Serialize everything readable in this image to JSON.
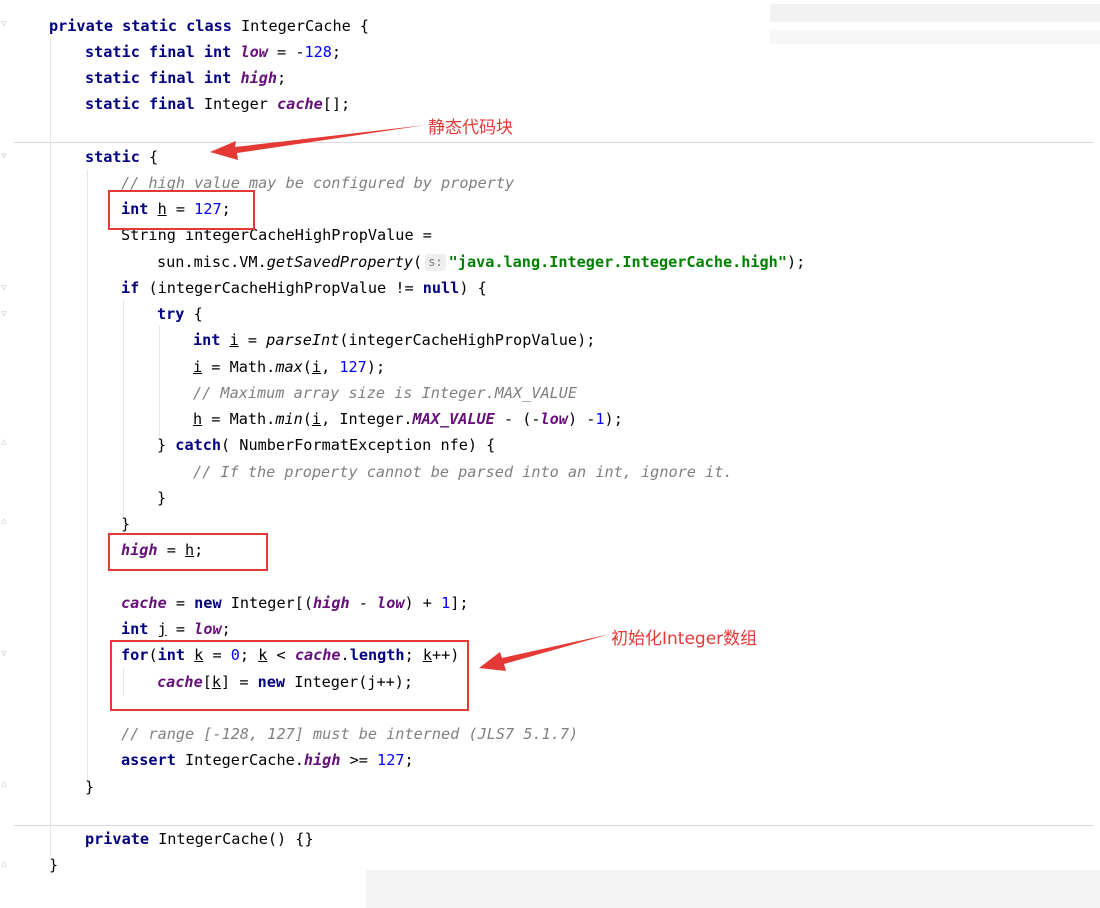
{
  "annotations": {
    "static_block_label": "静态代码块",
    "init_array_label": "初始化Integer数组",
    "colors": {
      "annotation_red": "#e53935"
    }
  },
  "editor": {
    "icons": [
      "fold-arrow-icon",
      "parameter-hint-icon"
    ],
    "colors": {
      "keyword": "#000080",
      "number": "#0000ff",
      "field": "#660e7a",
      "comment": "#808080",
      "string": "#008000",
      "text": "#000000"
    },
    "code_lines": [
      {
        "tokens": [
          {
            "t": "private static class ",
            "c": "kw"
          },
          {
            "t": "IntegerCache {"
          }
        ]
      },
      {
        "tokens": [
          {
            "t": "static final int ",
            "c": "kw"
          },
          {
            "t": "low",
            "c": "fld"
          },
          {
            "t": " = -"
          },
          {
            "t": "128",
            "c": "num"
          },
          {
            "t": ";"
          }
        ]
      },
      {
        "tokens": [
          {
            "t": "static final int ",
            "c": "kw"
          },
          {
            "t": "high",
            "c": "fld"
          },
          {
            "t": ";"
          }
        ]
      },
      {
        "tokens": [
          {
            "t": "static final ",
            "c": "kw"
          },
          {
            "t": "Integer "
          },
          {
            "t": "cache",
            "c": "fld"
          },
          {
            "t": "[];"
          }
        ]
      },
      {
        "tokens": [
          {
            "t": "static ",
            "c": "kw"
          },
          {
            "t": "{"
          }
        ]
      },
      {
        "tokens": [
          {
            "t": "// high value may be configured by property",
            "c": "cmt"
          }
        ]
      },
      {
        "tokens": [
          {
            "t": "int ",
            "c": "kw"
          },
          {
            "t": "h",
            "c": "ul"
          },
          {
            "t": " = "
          },
          {
            "t": "127",
            "c": "num"
          },
          {
            "t": ";"
          }
        ]
      },
      {
        "tokens": [
          {
            "t": "String integerCacheHighPropValue ="
          }
        ]
      },
      {
        "tokens": [
          {
            "t": "sun.misc.VM."
          },
          {
            "t": "getSavedProperty",
            "c": "mth"
          },
          {
            "t": "("
          },
          {
            "t": "s:",
            "c": "hint"
          },
          {
            "t": "\"java.lang.Integer.IntegerCache.high\"",
            "c": "str"
          },
          {
            "t": ");"
          }
        ]
      },
      {
        "tokens": [
          {
            "t": "if ",
            "c": "kw"
          },
          {
            "t": "(integerCacheHighPropValue != "
          },
          {
            "t": "null",
            "c": "kw"
          },
          {
            "t": ") {"
          }
        ]
      },
      {
        "tokens": [
          {
            "t": "try ",
            "c": "kw"
          },
          {
            "t": "{"
          }
        ]
      },
      {
        "tokens": [
          {
            "t": "int ",
            "c": "kw"
          },
          {
            "t": "i",
            "c": "ul"
          },
          {
            "t": " = "
          },
          {
            "t": "parseInt",
            "c": "mth"
          },
          {
            "t": "(integerCacheHighPropValue);"
          }
        ]
      },
      {
        "tokens": [
          {
            "t": "i",
            "c": "ul"
          },
          {
            "t": " = Math."
          },
          {
            "t": "max",
            "c": "mth"
          },
          {
            "t": "("
          },
          {
            "t": "i",
            "c": "ul"
          },
          {
            "t": ", "
          },
          {
            "t": "127",
            "c": "num"
          },
          {
            "t": ");"
          }
        ]
      },
      {
        "tokens": [
          {
            "t": "// Maximum array size is Integer.MAX_VALUE",
            "c": "cmt"
          }
        ]
      },
      {
        "tokens": [
          {
            "t": "h",
            "c": "ul"
          },
          {
            "t": " = Math."
          },
          {
            "t": "min",
            "c": "mth"
          },
          {
            "t": "("
          },
          {
            "t": "i",
            "c": "ul"
          },
          {
            "t": ", Integer."
          },
          {
            "t": "MAX_VALUE",
            "c": "fld"
          },
          {
            "t": " - (-"
          },
          {
            "t": "low",
            "c": "fld"
          },
          {
            "t": ") -"
          },
          {
            "t": "1",
            "c": "num"
          },
          {
            "t": ");"
          }
        ]
      },
      {
        "tokens": [
          {
            "t": "} "
          },
          {
            "t": "catch",
            "c": "kw"
          },
          {
            "t": "( NumberFormatException nfe) {"
          }
        ]
      },
      {
        "tokens": [
          {
            "t": "// If the property cannot be parsed into an int, ignore it.",
            "c": "cmt"
          }
        ]
      },
      {
        "tokens": [
          {
            "t": "}"
          }
        ]
      },
      {
        "tokens": [
          {
            "t": "}"
          }
        ]
      },
      {
        "tokens": [
          {
            "t": "high",
            "c": "fld"
          },
          {
            "t": " = "
          },
          {
            "t": "h",
            "c": "ul"
          },
          {
            "t": ";"
          }
        ]
      },
      {
        "tokens": [
          {
            "t": "cache",
            "c": "fld"
          },
          {
            "t": " = "
          },
          {
            "t": "new ",
            "c": "kw"
          },
          {
            "t": "Integer[("
          },
          {
            "t": "high",
            "c": "fld"
          },
          {
            "t": " - "
          },
          {
            "t": "low",
            "c": "fld"
          },
          {
            "t": ") + "
          },
          {
            "t": "1",
            "c": "num"
          },
          {
            "t": "];"
          }
        ]
      },
      {
        "tokens": [
          {
            "t": "int ",
            "c": "kw"
          },
          {
            "t": "j",
            "c": "ul"
          },
          {
            "t": " = "
          },
          {
            "t": "low",
            "c": "fld"
          },
          {
            "t": ";"
          }
        ]
      },
      {
        "tokens": [
          {
            "t": "for",
            "c": "kw"
          },
          {
            "t": "("
          },
          {
            "t": "int ",
            "c": "kw"
          },
          {
            "t": "k",
            "c": "ul"
          },
          {
            "t": " = "
          },
          {
            "t": "0",
            "c": "num"
          },
          {
            "t": "; "
          },
          {
            "t": "k",
            "c": "ul"
          },
          {
            "t": " < "
          },
          {
            "t": "cache",
            "c": "fld"
          },
          {
            "t": "."
          },
          {
            "t": "length",
            "c": "kw"
          },
          {
            "t": "; "
          },
          {
            "t": "k",
            "c": "ul"
          },
          {
            "t": "++)"
          }
        ]
      },
      {
        "tokens": [
          {
            "t": "cache",
            "c": "fld"
          },
          {
            "t": "["
          },
          {
            "t": "k",
            "c": "ul"
          },
          {
            "t": "] = "
          },
          {
            "t": "new ",
            "c": "kw"
          },
          {
            "t": "Integer(j++);"
          }
        ]
      },
      {
        "tokens": [
          {
            "t": "// range [-128, 127] must be interned (JLS7 5.1.7)",
            "c": "cmt"
          }
        ]
      },
      {
        "tokens": [
          {
            "t": "assert ",
            "c": "kw"
          },
          {
            "t": "IntegerCache."
          },
          {
            "t": "high",
            "c": "fld"
          },
          {
            "t": " >= "
          },
          {
            "t": "127",
            "c": "num"
          },
          {
            "t": ";"
          }
        ]
      },
      {
        "tokens": [
          {
            "t": "}"
          }
        ]
      },
      {
        "tokens": [
          {
            "t": "private ",
            "c": "kw"
          },
          {
            "t": "IntegerCache() {}"
          }
        ]
      },
      {
        "tokens": [
          {
            "t": "}"
          }
        ]
      }
    ]
  }
}
